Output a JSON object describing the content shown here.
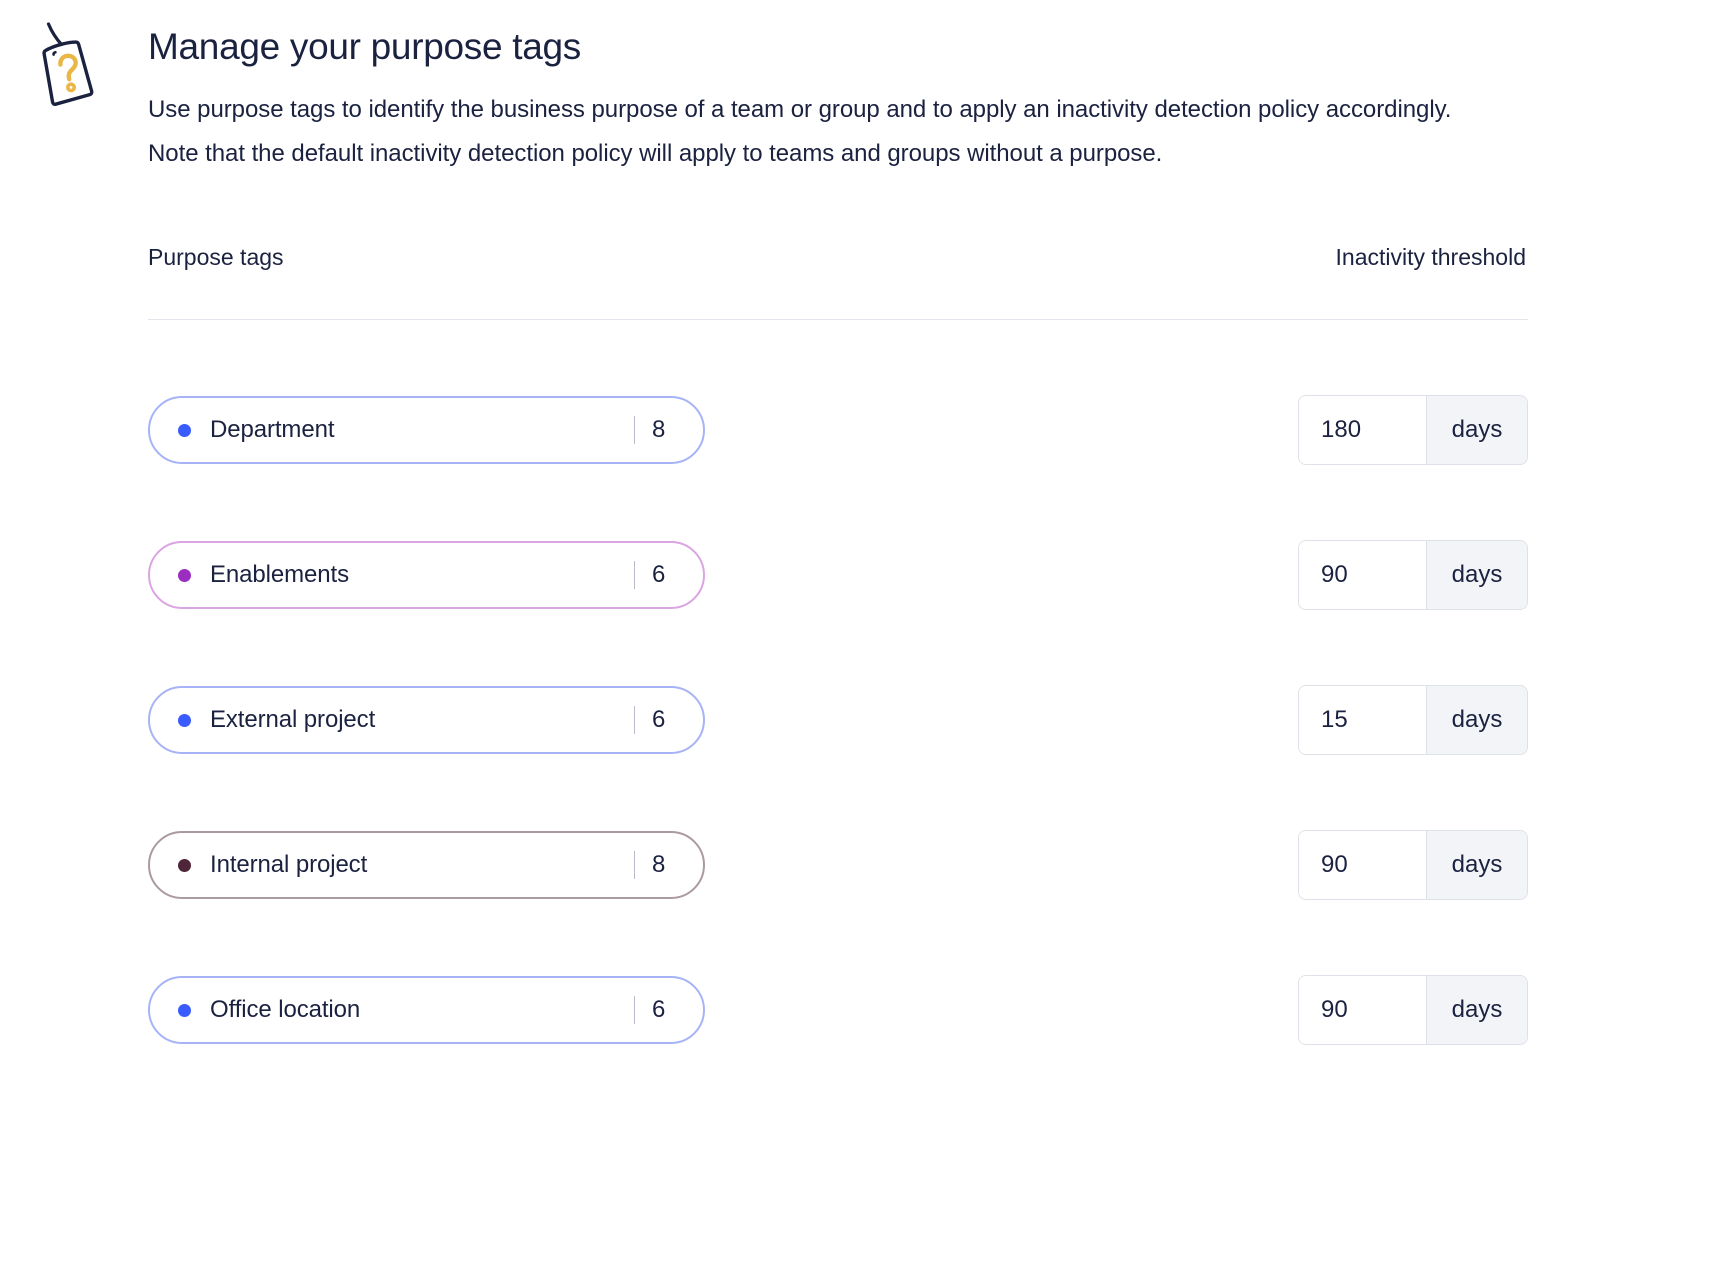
{
  "header": {
    "icon": "tag-question-icon",
    "title": "Manage your purpose tags",
    "description": "Use purpose tags to identify the business purpose of a team or group and to apply an inactivity detection policy accordingly. Note that the default inactivity detection policy will apply to teams and groups without a purpose."
  },
  "table": {
    "columns": {
      "tags": "Purpose tags",
      "threshold": "Inactivity threshold"
    },
    "rows": [
      {
        "label": "Department",
        "count": "8",
        "dot_color": "#3a5bfd",
        "border_color": "#a6b3f7",
        "threshold_value": "180",
        "threshold_unit": "days"
      },
      {
        "label": "Enablements",
        "count": "6",
        "dot_color": "#9b2ec0",
        "border_color": "#dba4e2",
        "threshold_value": "90",
        "threshold_unit": "days"
      },
      {
        "label": "External project",
        "count": "6",
        "dot_color": "#3a5bfd",
        "border_color": "#a6b3f7",
        "threshold_value": "15",
        "threshold_unit": "days"
      },
      {
        "label": "Internal project",
        "count": "8",
        "dot_color": "#4f2639",
        "border_color": "#ab9aa2",
        "threshold_value": "90",
        "threshold_unit": "days"
      },
      {
        "label": "Office location",
        "count": "6",
        "dot_color": "#3a5bfd",
        "border_color": "#a6b3f7",
        "threshold_value": "90",
        "threshold_unit": "days"
      }
    ]
  },
  "colors": {
    "text": "#1b2240",
    "divider": "#e3e5ec",
    "input_border": "#dfe1e8",
    "unit_background": "#f3f4f7",
    "icon_outline": "#1b2240",
    "icon_accent": "#eab646"
  }
}
